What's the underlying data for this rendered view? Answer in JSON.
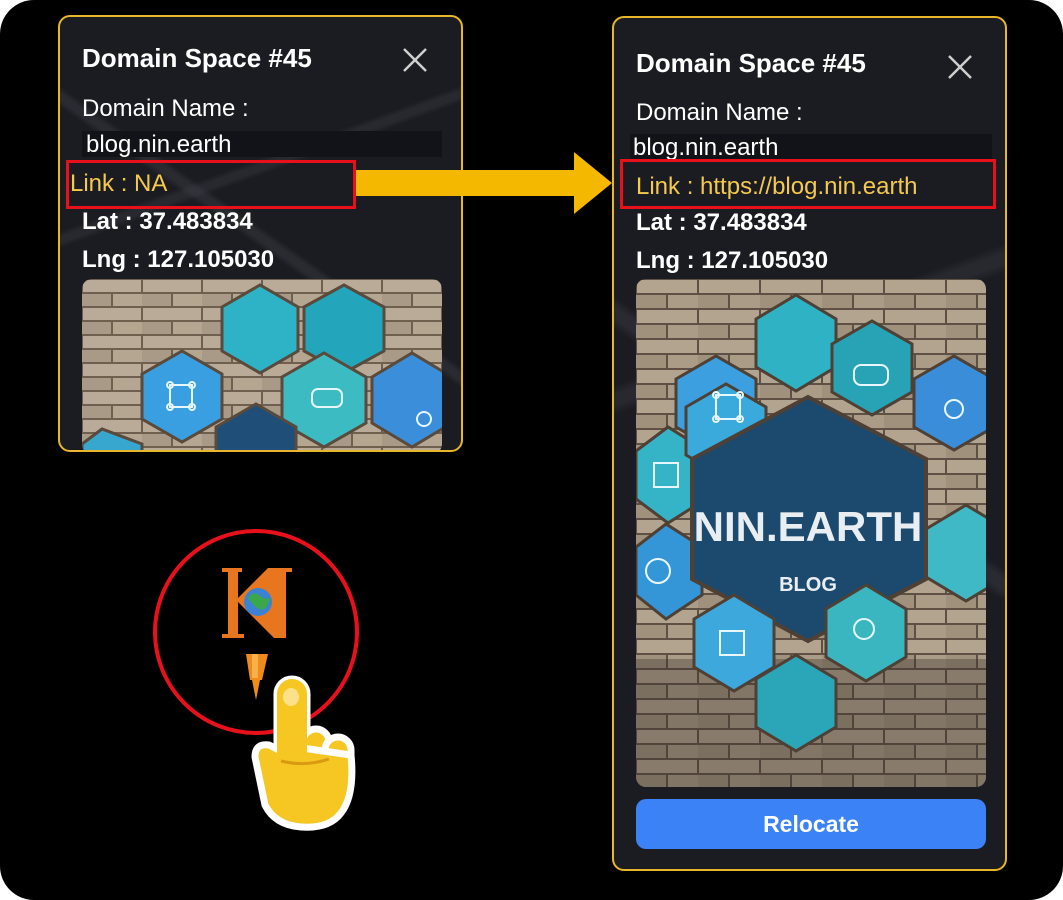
{
  "before_popup": {
    "title": "Domain Space #45",
    "domain_label": "Domain Name :",
    "domain_value": "blog.nin.earth",
    "link": "Link : NA",
    "lat": "Lat : 37.483834",
    "lng": "Lng : 127.105030"
  },
  "after_popup": {
    "title": "Domain Space #45",
    "domain_label": "Domain Name :",
    "domain_value": "blog.nin.earth",
    "link": "Link : https://blog.nin.earth",
    "lat": "Lat : 37.483834",
    "lng": "Lng : 127.105030",
    "image_title": "NIN.EARTH",
    "image_subtitle": "BLOG",
    "relocate_label": "Relocate"
  },
  "colors": {
    "popup_border": "#e8b62a",
    "link_text": "#f4c94e",
    "highlight": "#e8101a",
    "arrow": "#f5b800",
    "relocate_button": "#3b82f6"
  },
  "icons": [
    "close-icon",
    "arrow-right-icon",
    "nin-map-marker-icon",
    "pointing-hand-icon"
  ]
}
